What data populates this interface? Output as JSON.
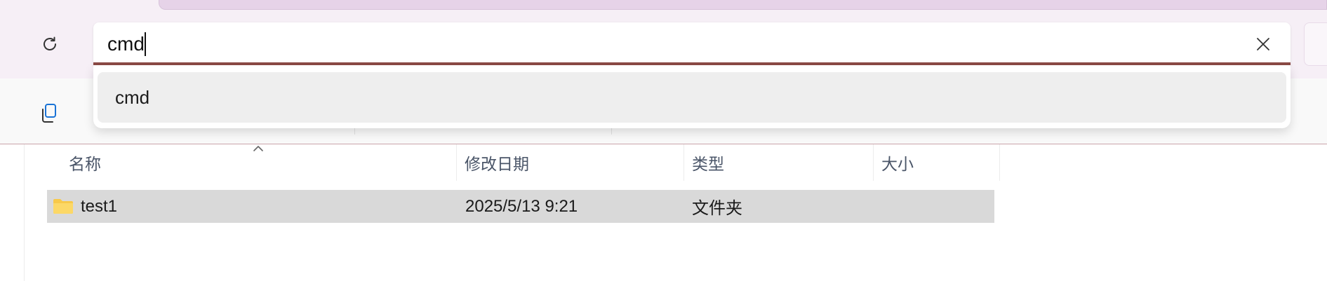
{
  "address_bar": {
    "value": "cmd",
    "refresh_icon": "refresh-icon",
    "clear_icon": "close-icon"
  },
  "suggestions": [
    {
      "label": "cmd"
    }
  ],
  "toolbar": {
    "copy_icon": "copy-icon"
  },
  "file_list": {
    "columns": [
      {
        "label": "名称"
      },
      {
        "label": "修改日期"
      },
      {
        "label": "类型"
      },
      {
        "label": "大小"
      }
    ],
    "rows": [
      {
        "name": "test1",
        "modified": "2025/5/13 9:21",
        "type": "文件夹",
        "size": "",
        "icon": "folder-icon"
      }
    ]
  },
  "colors": {
    "accent_underline": "#8b4a45",
    "title_band": "#f6eff6",
    "tab_strip": "#e6d3e8",
    "selected_row": "#d9d9d9",
    "header_text": "#4a5568",
    "folder_yellow": "#f8c94a"
  }
}
